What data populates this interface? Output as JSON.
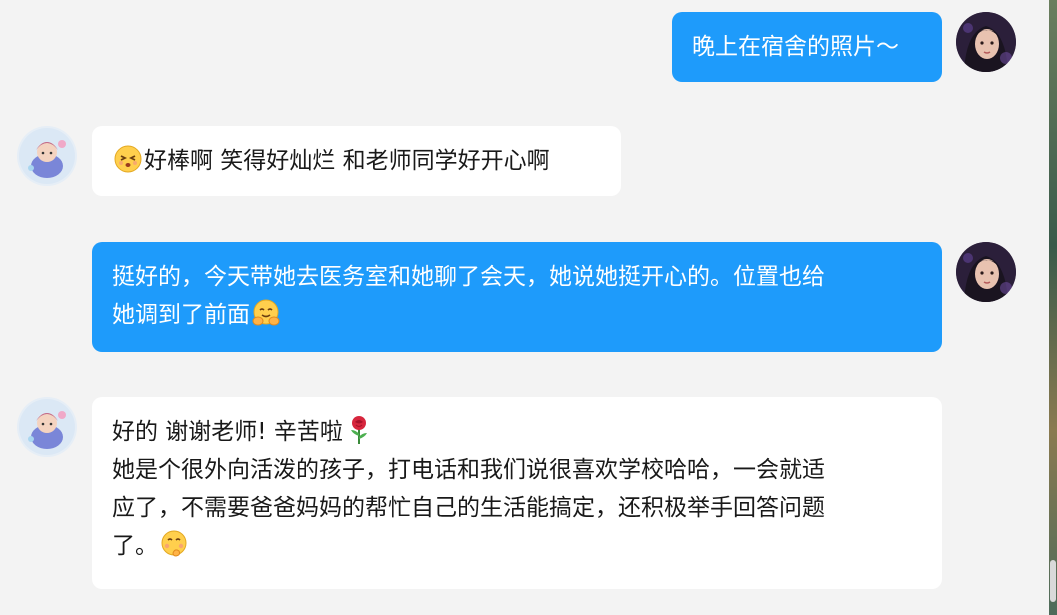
{
  "messages": [
    {
      "side": "out",
      "lines": [
        "晚上在宿舍的照片～"
      ]
    },
    {
      "side": "in",
      "lines": [
        "好棒啊 笑得好灿烂 和老师同学好开心啊"
      ],
      "leading_emoji": "grinning-squint-emoji"
    },
    {
      "side": "out",
      "lines": [
        "挺好的，今天带她去医务室和她聊了会天，她说她挺开心的。位置也给",
        "她调到了前面"
      ],
      "trailing_emoji": "hug-emoji"
    },
    {
      "side": "in",
      "lines": [
        "好的 谢谢老师! 辛苦啦",
        "她是个很外向活泼的孩子，打电话和我们说很喜欢学校哈哈，一会就适",
        "应了，不需要爸爸妈妈的帮忙自己的生活能搞定，还积极举手回答问题",
        "了。"
      ],
      "line_emojis": {
        "0": "rose-emoji",
        "3": "shy-emoji"
      }
    }
  ],
  "colors": {
    "out_bubble": "#1e9bfb",
    "in_bubble": "#ffffff",
    "background": "#f3f3f3"
  }
}
